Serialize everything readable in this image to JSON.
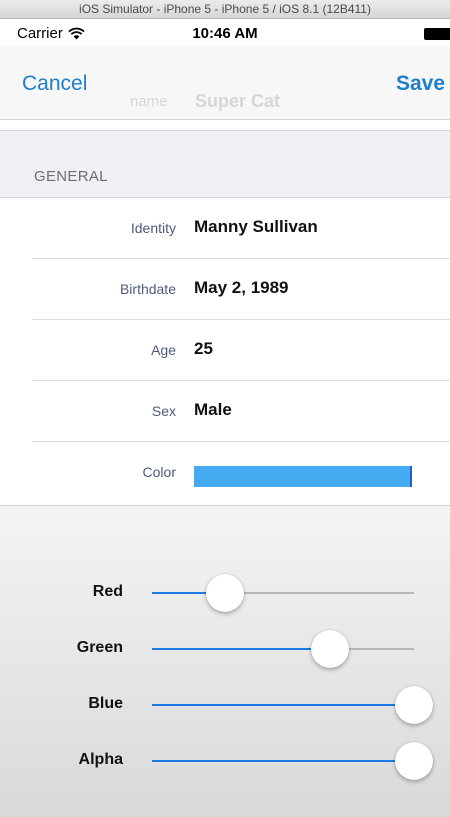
{
  "simulator": {
    "title": "iOS Simulator - iPhone 5 - iPhone 5 / iOS 8.1 (12B411)"
  },
  "statusbar": {
    "carrier": "Carrier",
    "time": "10:46 AM"
  },
  "navbar": {
    "cancel_label": "Cancel",
    "save_label": "Save",
    "ghost_left": "name",
    "ghost_right": "Super Cat"
  },
  "section": {
    "header": "GENERAL"
  },
  "rows": [
    {
      "label": "Identity",
      "value": "Manny Sullivan"
    },
    {
      "label": "Birthdate",
      "value": "May 2, 1989"
    },
    {
      "label": "Age",
      "value": "25"
    },
    {
      "label": "Sex",
      "value": "Male"
    },
    {
      "label": "Color",
      "value": "#45aaf2"
    }
  ],
  "color_picker": {
    "sliders": [
      {
        "label": "Red",
        "value": 0.28
      },
      {
        "label": "Green",
        "value": 0.68
      },
      {
        "label": "Blue",
        "value": 1.0
      },
      {
        "label": "Alpha",
        "value": 1.0
      }
    ]
  },
  "colors": {
    "accent": "#1d7fc9",
    "swatch": "#45aaf2",
    "slider_fill": "#1b7ae3"
  },
  "icons": {
    "wifi": "wifi-icon",
    "battery": "battery-icon"
  }
}
